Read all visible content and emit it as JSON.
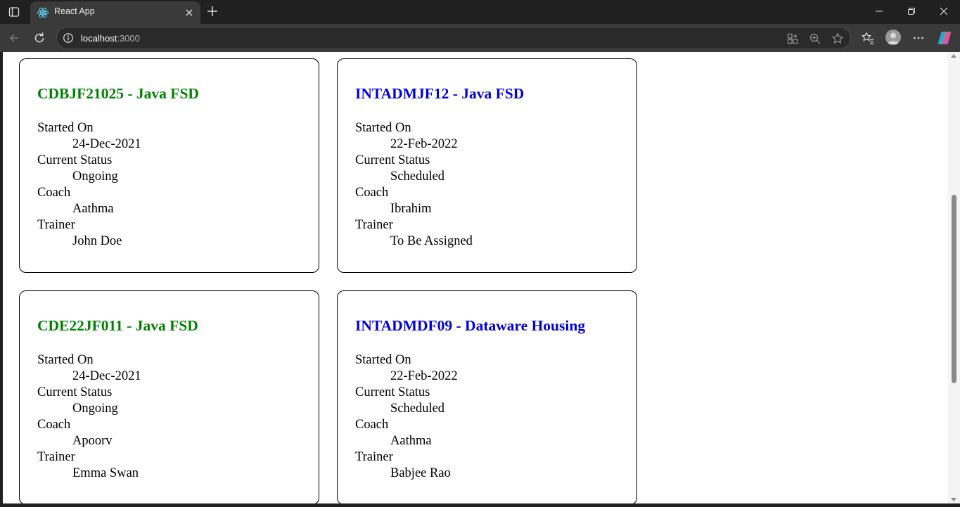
{
  "browser": {
    "tab_title": "React App",
    "url_host": "localhost",
    "url_port": ":3000"
  },
  "cohorts": [
    {
      "title": "CDBJF21025 - Java FSD",
      "title_color": "#008000",
      "started_label": "Started On",
      "started": "24-Dec-2021",
      "status_label": "Current Status",
      "status": "Ongoing",
      "coach_label": "Coach",
      "coach": "Aathma",
      "trainer_label": "Trainer",
      "trainer": "John Doe"
    },
    {
      "title": "INTADMJF12 - Java FSD",
      "title_color": "#0000dd",
      "started_label": "Started On",
      "started": "22-Feb-2022",
      "status_label": "Current Status",
      "status": "Scheduled",
      "coach_label": "Coach",
      "coach": "Ibrahim",
      "trainer_label": "Trainer",
      "trainer": "To Be Assigned"
    },
    {
      "title": "CDE22JF011 - Java FSD",
      "title_color": "#008000",
      "started_label": "Started On",
      "started": "24-Dec-2021",
      "status_label": "Current Status",
      "status": "Ongoing",
      "coach_label": "Coach",
      "coach": "Apoorv",
      "trainer_label": "Trainer",
      "trainer": "Emma Swan"
    },
    {
      "title": "INTADMDF09 - Dataware Housing",
      "title_color": "#0000dd",
      "started_label": "Started On",
      "started": "22-Feb-2022",
      "status_label": "Current Status",
      "status": "Scheduled",
      "coach_label": "Coach",
      "coach": "Aathma",
      "trainer_label": "Trainer",
      "trainer": "Babjee Rao"
    }
  ]
}
